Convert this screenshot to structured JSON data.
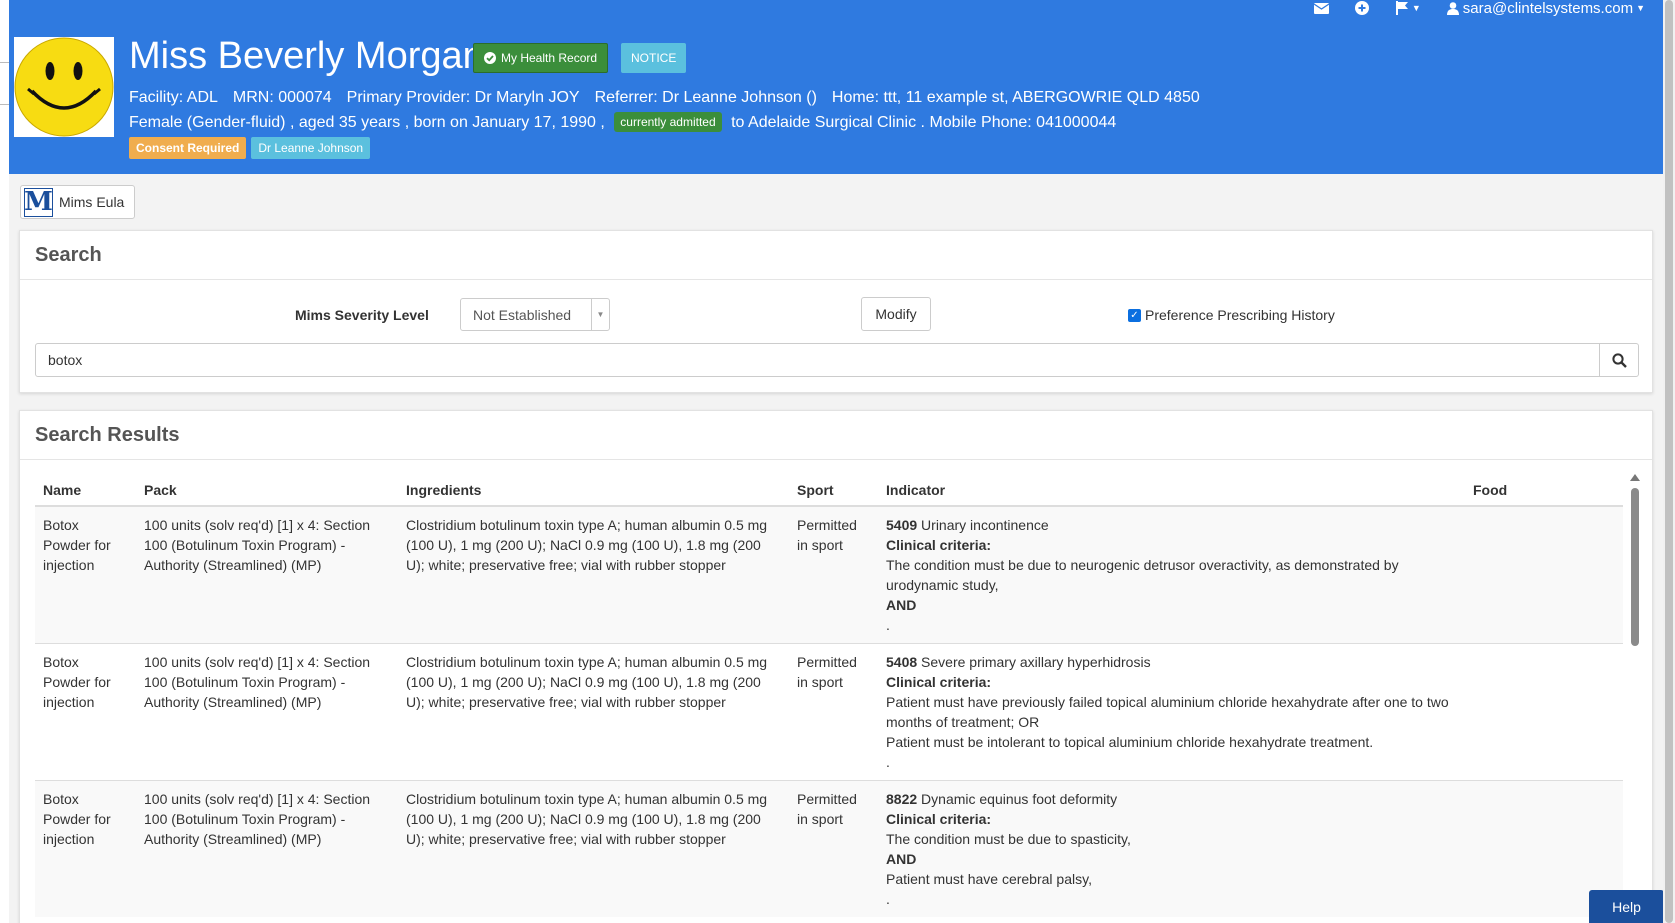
{
  "topnav": {
    "user_email": "sara@clintelsystems.com"
  },
  "patient": {
    "name": "Miss Beverly Morgan",
    "mhr_label": "My Health Record",
    "notice_label": "NOTICE",
    "facility": "Facility: ADL",
    "mrn": "MRN: 000074",
    "primary_provider": "Primary Provider: Dr Maryln JOY",
    "referrer": "Referrer: Dr Leanne Johnson ()",
    "home": "Home: ttt, 11 example st, ABERGOWRIE QLD 4850",
    "demographics": "Female (Gender-fluid) , aged 35 years , born on January 17, 1990 ,",
    "admitted_label": "currently admitted",
    "admission_text": "to Adelaide Surgical Clinic . Mobile Phone: 041000044",
    "consent_label": "Consent Required",
    "doctor_label": "Dr Leanne Johnson"
  },
  "mims_button": {
    "logo": "M",
    "label": "Mims Eula"
  },
  "search": {
    "title": "Search",
    "severity_label": "Mims Severity Level",
    "severity_value": "Not Established",
    "modify_label": "Modify",
    "preference_label": "Preference Prescribing History",
    "preference_checked": true,
    "query": "botox"
  },
  "results": {
    "title": "Search Results",
    "columns": [
      "Name",
      "Pack",
      "Ingredients",
      "Sport",
      "Indicator",
      "Food"
    ],
    "rows": [
      {
        "name": "Botox Powder for injection",
        "pack": "100 units (solv req'd) [1] x 4: Section 100 (Botulinum Toxin Program) - Authority (Streamlined) (MP)",
        "ingredients": "Clostridium botulinum toxin type A; human albumin 0.5 mg (100 U), 1 mg (200 U); NaCl 0.9 mg (100 U), 1.8 mg (200 U); white; preservative free; vial with rubber stopper",
        "sport": "Permitted in sport",
        "indicator_code": "5409",
        "indicator_title": "Urinary incontinence",
        "criteria_heading": "Clinical criteria:",
        "criteria_1": "The condition must be due to neurogenic detrusor overactivity, as demonstrated by urodynamic study,",
        "connector": "AND",
        "criteria_2": "",
        "end": ".",
        "food": ""
      },
      {
        "name": "Botox Powder for injection",
        "pack": "100 units (solv req'd) [1] x 4: Section 100 (Botulinum Toxin Program) - Authority (Streamlined) (MP)",
        "ingredients": "Clostridium botulinum toxin type A; human albumin 0.5 mg (100 U), 1 mg (200 U); NaCl 0.9 mg (100 U), 1.8 mg (200 U); white; preservative free; vial with rubber stopper",
        "sport": "Permitted in sport",
        "indicator_code": "5408",
        "indicator_title": "Severe primary axillary hyperhidrosis",
        "criteria_heading": "Clinical criteria:",
        "criteria_1": "Patient must have previously failed topical aluminium chloride hexahydrate after one to two months of treatment; OR",
        "connector": "",
        "criteria_2": "Patient must be intolerant to topical aluminium chloride hexahydrate treatment.",
        "end": ".",
        "food": ""
      },
      {
        "name": "Botox Powder for injection",
        "pack": "100 units (solv req'd) [1] x 4: Section 100 (Botulinum Toxin Program) - Authority (Streamlined) (MP)",
        "ingredients": "Clostridium botulinum toxin type A; human albumin 0.5 mg (100 U), 1 mg (200 U); NaCl 0.9 mg (100 U), 1.8 mg (200 U); white; preservative free; vial with rubber stopper",
        "sport": "Permitted in sport",
        "indicator_code": "8822",
        "indicator_title": "Dynamic equinus foot deformity",
        "criteria_heading": "Clinical criteria:",
        "criteria_1": "The condition must be due to spasticity,",
        "connector": "AND",
        "criteria_2": "Patient must have cerebral palsy,",
        "end": ".",
        "food": ""
      }
    ]
  },
  "help_label": "Help",
  "colors": {
    "header_blue": "#2f7ae0",
    "success_green": "#3b8e3b",
    "info_cyan": "#5bc0de",
    "warning_orange": "#f0ad4e",
    "help_navy": "#1b4f9c"
  },
  "icons": [
    "envelope-icon",
    "plus-circle-icon",
    "flag-icon",
    "user-icon",
    "search-icon",
    "check-circle-icon",
    "smiley-avatar"
  ]
}
